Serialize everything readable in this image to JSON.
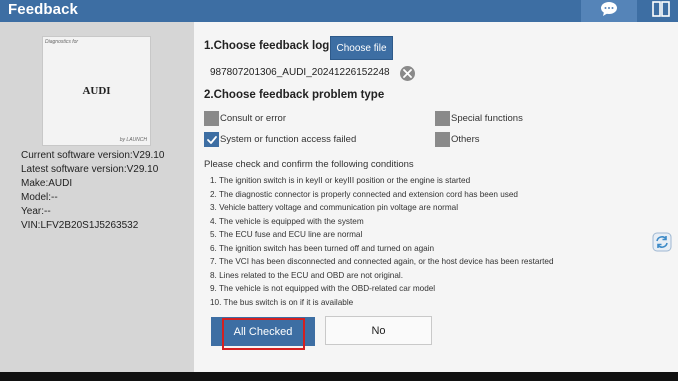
{
  "header": {
    "title": "Feedback",
    "icons": [
      "chat-icon",
      "split-screen-icon"
    ]
  },
  "vehicle": {
    "thumb_label": "Diagnostics for",
    "brand": "AUDI",
    "by_label": "by LAUNCH",
    "current_version": "Current software version:V29.10",
    "latest_version": "Latest software version:V29.10",
    "make": "Make:AUDI",
    "model": "Model:--",
    "year": "Year:--",
    "vin": "VIN:LFV2B20S1J5263532"
  },
  "step1": {
    "title": "1.Choose feedback log",
    "choose_button": "Choose file",
    "log_file": "987807201306_AUDI_20241226152248"
  },
  "step2": {
    "title": "2.Choose feedback problem type",
    "options": [
      {
        "label": "Consult or error",
        "checked": false
      },
      {
        "label": "Special functions",
        "checked": false
      },
      {
        "label": "System or function access failed",
        "checked": true
      },
      {
        "label": "Others",
        "checked": false
      }
    ]
  },
  "conditions": {
    "title": "Please check and confirm the following conditions",
    "items": [
      "1. The ignition switch is in keyII or keyIII position or the engine is started",
      "2. The diagnostic connector is properly connected and extension cord has been used",
      "3. Vehicle battery voltage and communication pin voltage are normal",
      "4. The vehicle is equipped with the system",
      "5. The ECU fuse and ECU line are normal",
      "6. The ignition switch has been turned off and turned on again",
      "7. The VCI has been disconnected and connected again, or the host device has been restarted",
      "8. Lines related to the ECU and OBD are not original.",
      "9. The vehicle is not equipped with the OBD-related car model",
      "10. The bus switch is on if it is available"
    ]
  },
  "buttons": {
    "all_checked": "All Checked",
    "no": "No"
  },
  "colors": {
    "accent": "#3d6ea3",
    "highlight": "#d42020"
  }
}
